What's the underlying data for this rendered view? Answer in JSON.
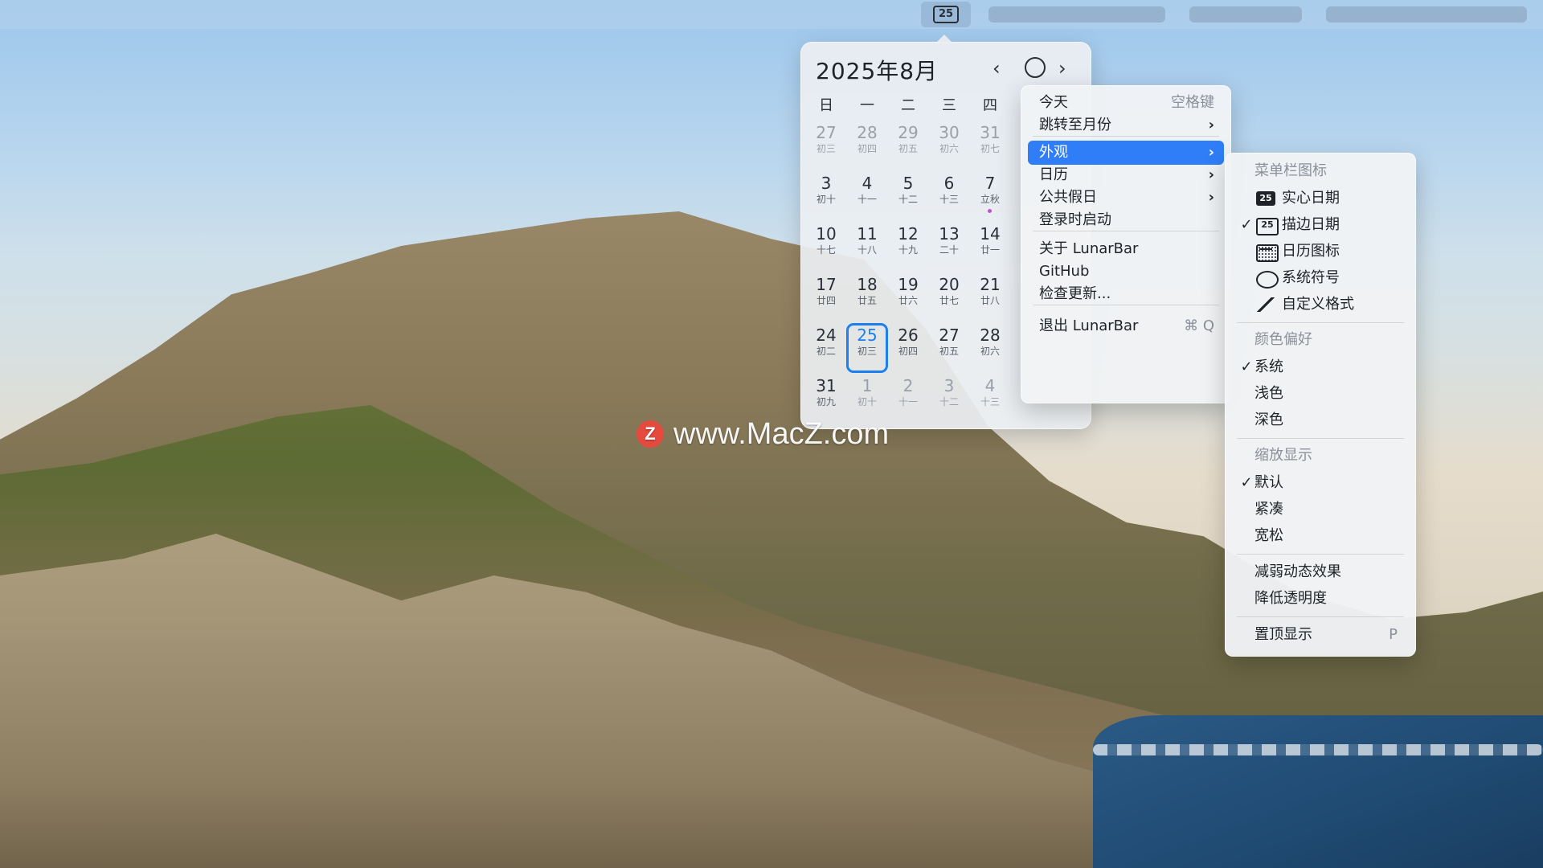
{
  "menubar": {
    "status_icon_label": "25"
  },
  "calendar": {
    "title": "2025年8月",
    "nav_prev": "‹",
    "nav_next": "›",
    "weekdays": [
      "日",
      "一",
      "二",
      "三",
      "四"
    ],
    "weeks": [
      [
        {
          "d": "27",
          "l": "初三",
          "muted": true
        },
        {
          "d": "28",
          "l": "初四",
          "muted": true
        },
        {
          "d": "29",
          "l": "初五",
          "muted": true
        },
        {
          "d": "30",
          "l": "初六",
          "muted": true
        },
        {
          "d": "31",
          "l": "初七",
          "muted": true
        }
      ],
      [
        {
          "d": "3",
          "l": "初十"
        },
        {
          "d": "4",
          "l": "十一"
        },
        {
          "d": "5",
          "l": "十二"
        },
        {
          "d": "6",
          "l": "十三"
        },
        {
          "d": "7",
          "l": "立秋",
          "dot": true
        }
      ],
      [
        {
          "d": "10",
          "l": "十七"
        },
        {
          "d": "11",
          "l": "十八"
        },
        {
          "d": "12",
          "l": "十九"
        },
        {
          "d": "13",
          "l": "二十"
        },
        {
          "d": "14",
          "l": "廿一"
        }
      ],
      [
        {
          "d": "17",
          "l": "廿四"
        },
        {
          "d": "18",
          "l": "廿五"
        },
        {
          "d": "19",
          "l": "廿六"
        },
        {
          "d": "20",
          "l": "廿七"
        },
        {
          "d": "21",
          "l": "廿八"
        }
      ],
      [
        {
          "d": "24",
          "l": "初二"
        },
        {
          "d": "25",
          "l": "初三",
          "today": true
        },
        {
          "d": "26",
          "l": "初四"
        },
        {
          "d": "27",
          "l": "初五"
        },
        {
          "d": "28",
          "l": "初六"
        }
      ],
      [
        {
          "d": "31",
          "l": "初九"
        },
        {
          "d": "1",
          "l": "初十",
          "muted": true
        },
        {
          "d": "2",
          "l": "十一",
          "muted": true
        },
        {
          "d": "3",
          "l": "十二",
          "muted": true
        },
        {
          "d": "4",
          "l": "十三",
          "muted": true
        }
      ]
    ],
    "today_color": "#1b7ff0",
    "festival_dot_color": "#c74fd6"
  },
  "context_menu": {
    "items": [
      {
        "label": "今天",
        "shortcut": "空格键"
      },
      {
        "label": "跳转至月份",
        "chevron": "›"
      },
      {
        "label": "外观",
        "chevron": "›",
        "selected": true
      },
      {
        "label": "日历",
        "chevron": "›"
      },
      {
        "label": "公共假日",
        "chevron": "›"
      },
      {
        "label": "登录时启动"
      },
      {
        "label": "关于 LunarBar"
      },
      {
        "label": "GitHub"
      },
      {
        "label": "检查更新..."
      },
      {
        "label": "退出 LunarBar",
        "shortcut": "⌘ Q"
      }
    ],
    "selected_color": "#2f7ef7"
  },
  "appearance_submenu": {
    "sections": [
      {
        "header": "菜单栏图标",
        "items": [
          {
            "label": "实心日期",
            "icon": "filled-date-icon",
            "icon_text": "25"
          },
          {
            "label": "描边日期",
            "icon": "outlined-date-icon",
            "icon_text": "25",
            "checked": true
          },
          {
            "label": "日历图标",
            "icon": "calendar-icon"
          },
          {
            "label": "系统符号",
            "icon": "gear-icon"
          },
          {
            "label": "自定义格式",
            "icon": "magic-wand-icon"
          }
        ]
      },
      {
        "header": "颜色偏好",
        "items": [
          {
            "label": "系统",
            "checked": true
          },
          {
            "label": "浅色"
          },
          {
            "label": "深色"
          }
        ]
      },
      {
        "header": "缩放显示",
        "items": [
          {
            "label": "默认",
            "checked": true
          },
          {
            "label": "紧凑"
          },
          {
            "label": "宽松"
          }
        ]
      },
      {
        "items": [
          {
            "label": "减弱动态效果"
          },
          {
            "label": "降低透明度"
          }
        ]
      },
      {
        "items": [
          {
            "label": "置顶显示",
            "shortcut": "P"
          }
        ]
      }
    ],
    "checkmark": "✓"
  },
  "watermark": {
    "logo_text": "Z",
    "text": "www.MacZ.com"
  }
}
